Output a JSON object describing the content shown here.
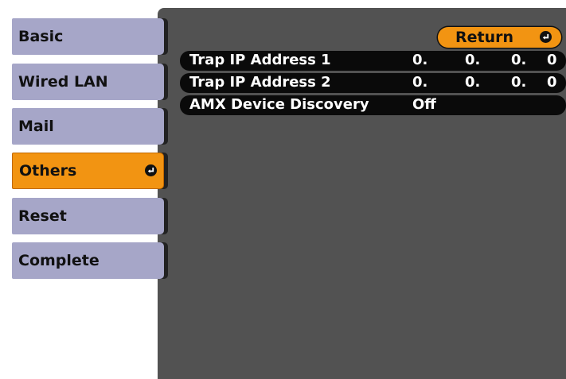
{
  "sidebar": {
    "items": [
      {
        "label": "Basic"
      },
      {
        "label": "Wired LAN"
      },
      {
        "label": "Mail"
      },
      {
        "label": "Others",
        "selected": true,
        "icon": "enter-icon"
      },
      {
        "label": "Reset"
      },
      {
        "label": "Complete"
      }
    ]
  },
  "main": {
    "return_label": "Return",
    "settings": [
      {
        "label": "Trap IP Address 1",
        "octets": [
          "0.",
          "0.",
          "0.",
          "0"
        ]
      },
      {
        "label": "Trap IP Address 2",
        "octets": [
          "0.",
          "0.",
          "0.",
          "0"
        ]
      },
      {
        "label": "AMX Device Discovery",
        "value": "Off"
      }
    ]
  },
  "colors": {
    "panel_bg": "#525252",
    "menu_item_bg": "#a6a6c8",
    "accent_orange": "#f29412",
    "row_bg": "#0a0a0a"
  }
}
